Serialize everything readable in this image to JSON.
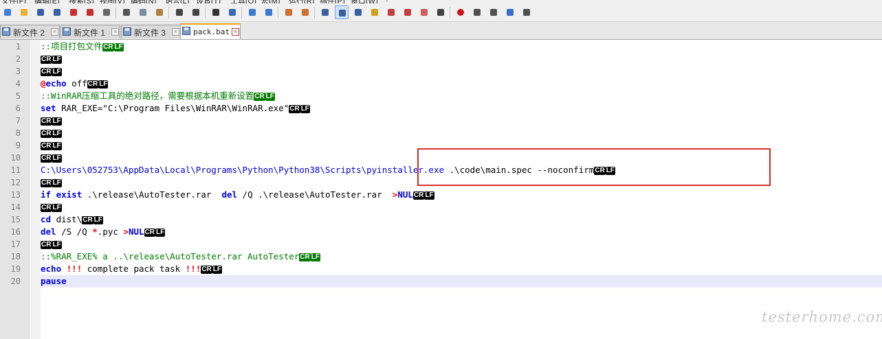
{
  "menubar": [
    "文件(F)",
    "编辑(E)",
    "搜索(S)",
    "视图(V)",
    "编码(N)",
    "语言(L)",
    "设置(T)",
    "工具(O)",
    "宏(M)",
    "运行(R)",
    "插件(P)",
    "窗口(W)",
    "?"
  ],
  "toolbar": {
    "groups": [
      [
        "new-file",
        "open-file",
        "save",
        "save-all",
        "close",
        "close-all",
        "print"
      ],
      [
        "cut",
        "copy",
        "paste"
      ],
      [
        "undo",
        "redo"
      ],
      [
        "find",
        "replace"
      ],
      [
        "zoom-in",
        "zoom-out"
      ],
      [
        "sync-vertical",
        "sync-horizontal"
      ],
      [
        "word-wrap",
        "show-all-characters",
        "indent-guide",
        "user-defined-language",
        "document-map",
        "function-list",
        "folder-as-workspace",
        "monitoring"
      ],
      [
        "record-macro",
        "stop-recording",
        "play-macro",
        "run-macro-multiple",
        "save-macro"
      ]
    ],
    "colors": {
      "new-file": "#3f7fd9",
      "open-file": "#e8b23a",
      "save": "#3a5fa0",
      "save-all": "#3a5fa0",
      "close": "#c33030",
      "close-all": "#c33030",
      "print": "#666666",
      "cut": "#555555",
      "copy": "#7a8aa0",
      "paste": "#b08040",
      "undo": "#444444",
      "redo": "#444444",
      "find": "#333333",
      "replace": "#3a6ab0",
      "zoom-in": "#3a7ad0",
      "zoom-out": "#3a7ad0",
      "sync-vertical": "#d07030",
      "sync-horizontal": "#d07030",
      "word-wrap": "#3a5fa0",
      "show-all-characters": "#3a5fa0",
      "indent-guide": "#3a5fa0",
      "user-defined-language": "#d0a020",
      "document-map": "#c04040",
      "function-list": "#c04040",
      "folder-as-workspace": "#d06060",
      "monitoring": "#404040",
      "record-macro": "#d01010",
      "stop-recording": "#505050",
      "play-macro": "#505050",
      "run-macro-multiple": "#3a6ad0",
      "save-macro": "#505050"
    }
  },
  "tabs": [
    {
      "label": "新文件 2",
      "active": false
    },
    {
      "label": "新文件 1",
      "active": false
    },
    {
      "label": "新文件 3",
      "active": false
    },
    {
      "label": "pack.bat",
      "active": true
    }
  ],
  "editor": {
    "current_line": 20,
    "lines": [
      {
        "n": "1",
        "tokens": [
          {
            "t": "::项目打包文件",
            "c": "comment"
          },
          {
            "t": "CR",
            "c": "eol green"
          },
          {
            "t": "LF",
            "c": "eol green"
          }
        ]
      },
      {
        "n": "2",
        "tokens": [
          {
            "t": "CR",
            "c": "eol"
          },
          {
            "t": "LF",
            "c": "eol"
          }
        ]
      },
      {
        "n": "3",
        "tokens": [
          {
            "t": "CR",
            "c": "eol"
          },
          {
            "t": "LF",
            "c": "eol"
          }
        ]
      },
      {
        "n": "4",
        "tokens": [
          {
            "t": "@",
            "c": "redop"
          },
          {
            "t": "echo",
            "c": "kw"
          },
          {
            "t": " off",
            "c": ""
          },
          {
            "t": "CR",
            "c": "eol"
          },
          {
            "t": "LF",
            "c": "eol"
          }
        ]
      },
      {
        "n": "5",
        "tokens": [
          {
            "t": "::WinRAR压缩工具的绝对路径，需要根据本机重新设置",
            "c": "comment"
          },
          {
            "t": "CR",
            "c": "eol green"
          },
          {
            "t": "LF",
            "c": "eol green"
          }
        ]
      },
      {
        "n": "6",
        "tokens": [
          {
            "t": "set",
            "c": "kw"
          },
          {
            "t": " RAR_EXE=\"C:\\Program Files\\WinRAR\\WinRAR.exe\"",
            "c": ""
          },
          {
            "t": "CR",
            "c": "eol"
          },
          {
            "t": "LF",
            "c": "eol"
          }
        ]
      },
      {
        "n": "7",
        "tokens": [
          {
            "t": "CR",
            "c": "eol"
          },
          {
            "t": "LF",
            "c": "eol"
          }
        ]
      },
      {
        "n": "8",
        "tokens": [
          {
            "t": "CR",
            "c": "eol"
          },
          {
            "t": "LF",
            "c": "eol"
          }
        ]
      },
      {
        "n": "9",
        "tokens": [
          {
            "t": "CR",
            "c": "eol"
          },
          {
            "t": "LF",
            "c": "eol"
          }
        ]
      },
      {
        "n": "10",
        "tokens": [
          {
            "t": "CR",
            "c": "eol"
          },
          {
            "t": "LF",
            "c": "eol"
          }
        ]
      },
      {
        "n": "11",
        "tokens": [
          {
            "t": "C:\\Users\\052753\\AppData\\Local\\Programs\\Python\\Python38\\Scripts\\pyinstaller.exe",
            "c": "path"
          },
          {
            "t": " .\\code\\main.spec --noconfirm",
            "c": ""
          },
          {
            "t": "CR",
            "c": "eol"
          },
          {
            "t": "LF",
            "c": "eol"
          }
        ]
      },
      {
        "n": "12",
        "tokens": [
          {
            "t": "CR",
            "c": "eol"
          },
          {
            "t": "LF",
            "c": "eol"
          }
        ]
      },
      {
        "n": "13",
        "tokens": [
          {
            "t": "if",
            "c": "kw"
          },
          {
            "t": " ",
            "c": ""
          },
          {
            "t": "exist",
            "c": "kw"
          },
          {
            "t": " .\\release\\AutoTester.rar  ",
            "c": ""
          },
          {
            "t": "del",
            "c": "kw"
          },
          {
            "t": " /Q .\\release\\AutoTester.rar  ",
            "c": ""
          },
          {
            "t": ">",
            "c": "redop"
          },
          {
            "t": "NUL",
            "c": "nul"
          },
          {
            "t": "CR",
            "c": "eol"
          },
          {
            "t": "LF",
            "c": "eol"
          }
        ]
      },
      {
        "n": "14",
        "tokens": [
          {
            "t": "CR",
            "c": "eol"
          },
          {
            "t": "LF",
            "c": "eol"
          }
        ]
      },
      {
        "n": "15",
        "tokens": [
          {
            "t": "cd",
            "c": "kw"
          },
          {
            "t": " dist\\",
            "c": ""
          },
          {
            "t": "CR",
            "c": "eol"
          },
          {
            "t": "LF",
            "c": "eol"
          }
        ]
      },
      {
        "n": "16",
        "tokens": [
          {
            "t": "del",
            "c": "kw"
          },
          {
            "t": " /S /Q ",
            "c": ""
          },
          {
            "t": "*",
            "c": "redop"
          },
          {
            "t": ".pyc ",
            "c": ""
          },
          {
            "t": ">",
            "c": "redop"
          },
          {
            "t": "NUL",
            "c": "nul"
          },
          {
            "t": "CR",
            "c": "eol"
          },
          {
            "t": "LF",
            "c": "eol"
          }
        ]
      },
      {
        "n": "17",
        "tokens": [
          {
            "t": "CR",
            "c": "eol"
          },
          {
            "t": "LF",
            "c": "eol"
          }
        ]
      },
      {
        "n": "18",
        "tokens": [
          {
            "t": "::%RAR_EXE% a ..\\release\\AutoTester.rar AutoTester",
            "c": "comment"
          },
          {
            "t": "CR",
            "c": "eol green"
          },
          {
            "t": "LF",
            "c": "eol green"
          }
        ]
      },
      {
        "n": "19",
        "tokens": [
          {
            "t": "echo",
            "c": "kw"
          },
          {
            "t": " ",
            "c": ""
          },
          {
            "t": "!!!",
            "c": "redop"
          },
          {
            "t": " complete pack task ",
            "c": ""
          },
          {
            "t": "!!!",
            "c": "redop"
          },
          {
            "t": "CR",
            "c": "eol"
          },
          {
            "t": "LF",
            "c": "eol"
          }
        ]
      },
      {
        "n": "20",
        "tokens": [
          {
            "t": "pause",
            "c": "kw"
          }
        ]
      }
    ]
  },
  "watermark": "testerhome.com"
}
